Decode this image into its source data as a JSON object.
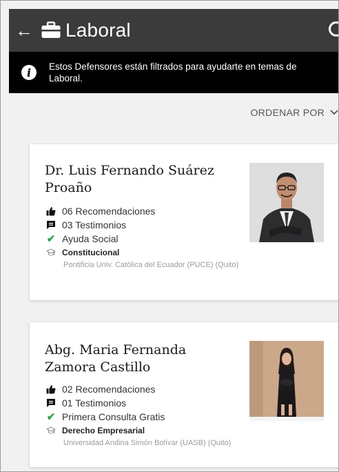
{
  "header": {
    "title": "Laboral"
  },
  "banner": {
    "text": "Estos Defensores están filtrados para ayudarte en temas de Laboral."
  },
  "sort": {
    "label": "ORDENAR POR"
  },
  "defenders": [
    {
      "name": "Dr. Luis Fernando Suárez Proaño",
      "recommendations": "06 Recomendaciones",
      "testimonials": "03 Testimonios",
      "feature": "Ayuda Social",
      "specialty": "Constitucional",
      "university": "Pontificia Univ. Católica del Ecuador (PUCE) (Quito)"
    },
    {
      "name": "Abg. Maria Fernanda Zamora Castillo",
      "recommendations": "02 Recomendaciones",
      "testimonials": "01 Testimonios",
      "feature": "Primera Consulta Gratis",
      "specialty": "Derecho Empresarial",
      "university": "Universidad Andina Simón Bolívar (UASB) (Quito)"
    }
  ],
  "colors": {
    "appbar": "#3b3b3b",
    "banner": "#000000",
    "check": "#2fa34a",
    "background": "#f1f1f1"
  },
  "icons": [
    "back-arrow-icon",
    "briefcase-icon",
    "search-icon",
    "info-icon",
    "chevron-down-icon",
    "thumbs-up-icon",
    "chat-bubble-icon",
    "check-icon",
    "graduation-cap-icon"
  ]
}
